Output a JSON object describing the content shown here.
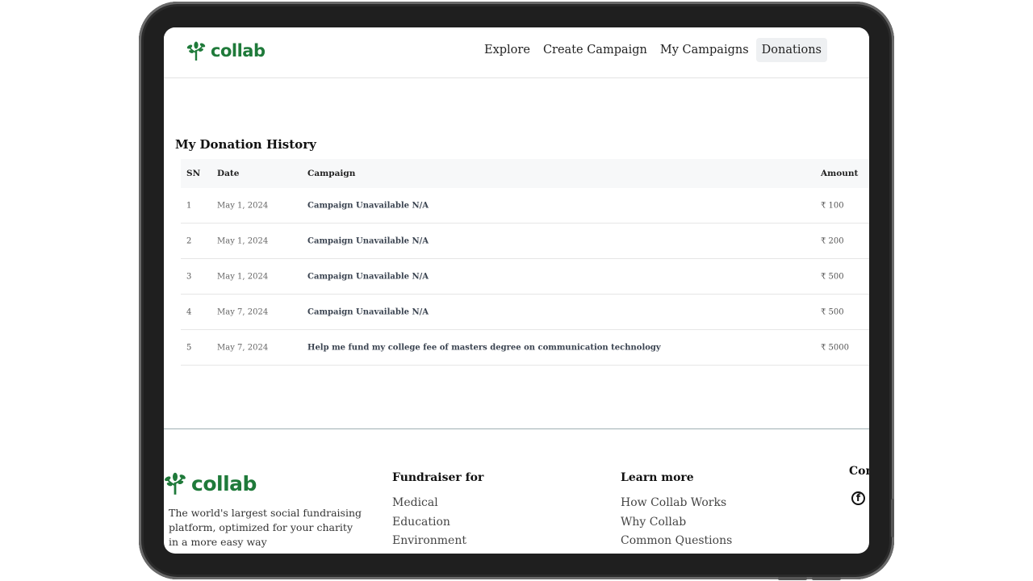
{
  "brand": {
    "name": "collab",
    "color": "#1f7a3a",
    "icon": "tree-sprout-icon"
  },
  "nav": {
    "items": [
      {
        "label": "Explore",
        "active": false
      },
      {
        "label": "Create Campaign",
        "active": false
      },
      {
        "label": "My Campaigns",
        "active": false
      },
      {
        "label": "Donations",
        "active": true
      }
    ]
  },
  "history": {
    "title": "My Donation History",
    "headers": {
      "sn": "SN",
      "date": "Date",
      "campaign": "Campaign",
      "amount": "Amount"
    },
    "rows": [
      {
        "sn": "1",
        "date": "May 1, 2024",
        "campaign": "Campaign Unavailable N/A",
        "amount": "₹ 100"
      },
      {
        "sn": "2",
        "date": "May 1, 2024",
        "campaign": "Campaign Unavailable N/A",
        "amount": "₹ 200"
      },
      {
        "sn": "3",
        "date": "May 1, 2024",
        "campaign": "Campaign Unavailable N/A",
        "amount": "₹ 500"
      },
      {
        "sn": "4",
        "date": "May 7, 2024",
        "campaign": "Campaign Unavailable N/A",
        "amount": "₹ 500"
      },
      {
        "sn": "5",
        "date": "May 7, 2024",
        "campaign": "Help me fund my college fee of masters degree on communication technology",
        "amount": "₹ 5000"
      }
    ]
  },
  "footer": {
    "description": "The world's largest social fundraising platform, optimized for your charity in a more easy way",
    "fundraiser": {
      "title": "Fundraiser for",
      "links": [
        "Medical",
        "Education",
        "Environment"
      ]
    },
    "learn": {
      "title": "Learn more",
      "links": [
        "How Collab Works",
        "Why Collab",
        "Common Questions"
      ]
    },
    "contact": {
      "title": "Con",
      "icon": "facebook-icon"
    }
  }
}
